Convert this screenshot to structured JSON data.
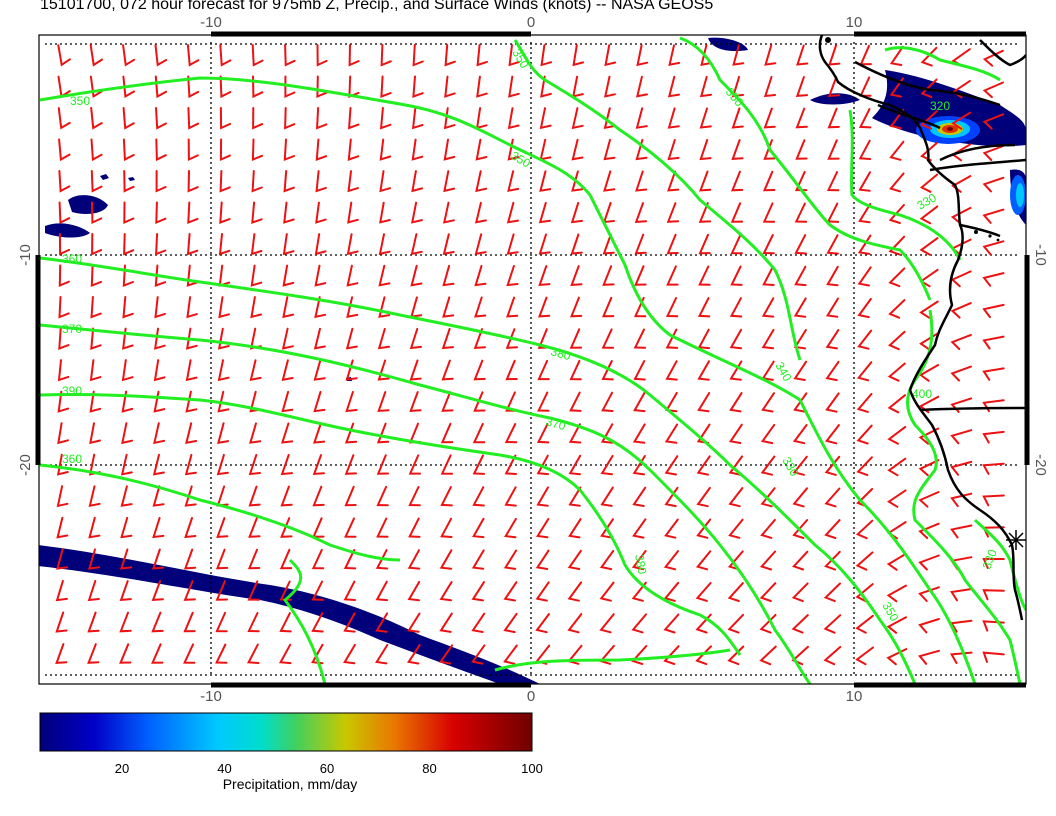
{
  "title": "15101700, 072 hour forecast for 975mb Z, Precip., and Surface Winds (knots) -- NASA GEOS5",
  "map": {
    "lon_range": [
      -15.5,
      15
    ],
    "lat_range": [
      -30,
      0
    ],
    "lon_ticks": [
      -10,
      0,
      10
    ],
    "lat_ticks": [
      -10,
      -20
    ],
    "gridlines": true,
    "colors": {
      "contour": "#22ee22",
      "wind_barb": "#ee1111",
      "coast": "#000000",
      "precip_low": "#00007a"
    },
    "contour_labels": [
      "350",
      "350",
      "350",
      "350",
      "360",
      "370",
      "380",
      "390",
      "360",
      "370",
      "340",
      "330",
      "380",
      "350",
      "330",
      "320",
      "400",
      "330"
    ]
  },
  "colorbar": {
    "label": "Precipitation, mm/day",
    "ticks": [
      20,
      40,
      60,
      80,
      100
    ],
    "min": 4,
    "max": 100,
    "colors": [
      "#000078",
      "#0000c8",
      "#0060ff",
      "#00c8ff",
      "#00ddcc",
      "#40d060",
      "#c8c800",
      "#e87800",
      "#d80000",
      "#700000"
    ]
  }
}
